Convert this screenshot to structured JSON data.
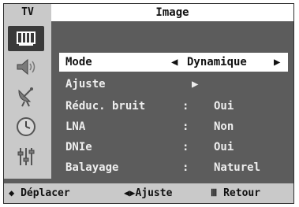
{
  "header": {
    "tv_label": "TV",
    "title": "Image"
  },
  "sidebar": {
    "icons": [
      "picture-icon",
      "sound-icon",
      "channel-antenna-icon",
      "timer-clock-icon",
      "setup-sliders-icon"
    ],
    "active_index": 0
  },
  "menu": {
    "items": [
      {
        "label": "Mode",
        "left_arrow": "◀",
        "value": "Dynamique",
        "right_arrow": "▶",
        "selected": true
      },
      {
        "label": "Ajuste",
        "arrow": "▶"
      },
      {
        "label": "Réduc. bruit",
        "sep": ":",
        "value": "Oui"
      },
      {
        "label": "LNA",
        "sep": ":",
        "value": "Non"
      },
      {
        "label": "DNIe",
        "sep": ":",
        "value": "Oui"
      },
      {
        "label": "Balayage",
        "sep": ":",
        "value": "Naturel"
      }
    ]
  },
  "footer": {
    "move_symbol": "◆",
    "move_label": "Déplacer",
    "adjust_symbol": "◀▶",
    "adjust_label": "Ajuste",
    "return_symbol": "Ⅲ",
    "return_label": "Retour"
  },
  "colors": {
    "panel_bg": "#5c5c5c",
    "bar_bg": "#c9c9c9",
    "highlight_bg": "#ffffff",
    "text_light": "#eeeeee",
    "text_dark": "#111111"
  }
}
